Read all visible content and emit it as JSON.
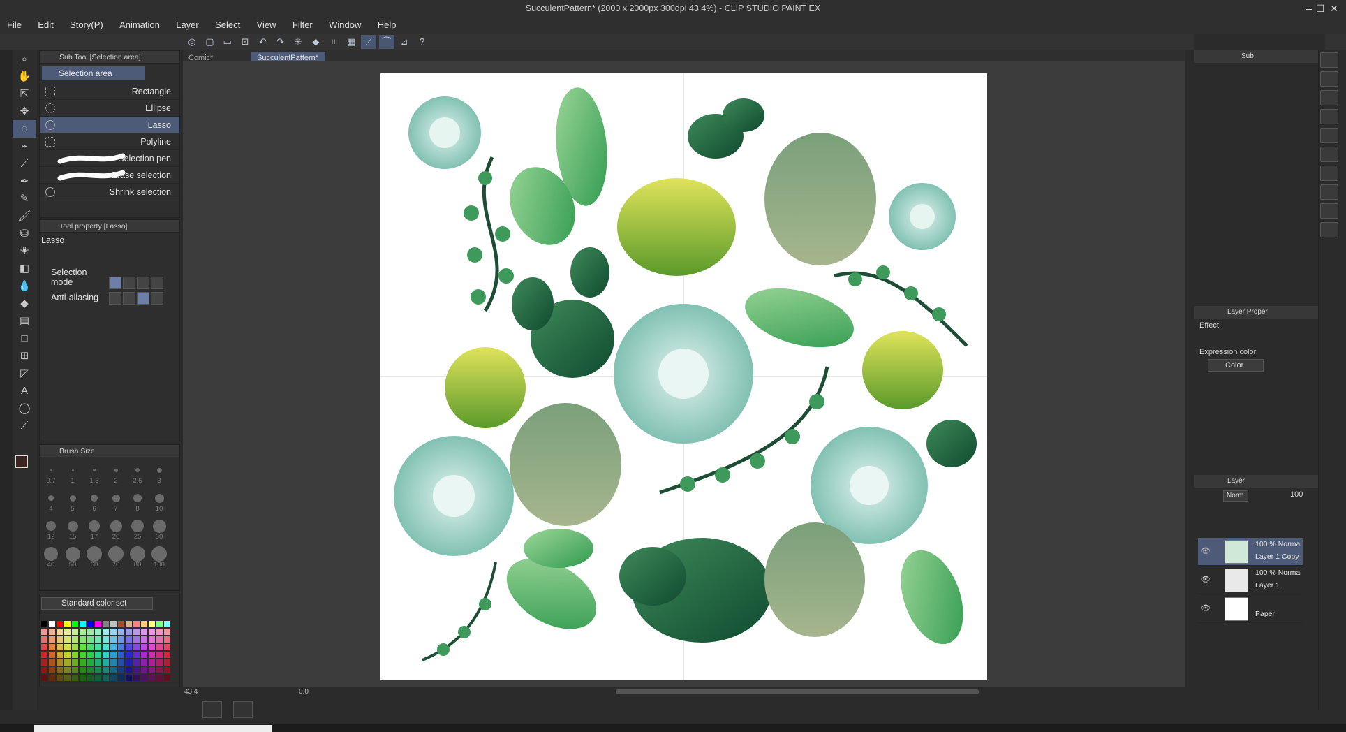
{
  "window": {
    "title": "SucculentPattern* (2000 x 2000px 300dpi 43.4%)  - CLIP STUDIO PAINT EX"
  },
  "menu": [
    "File",
    "Edit",
    "Story(P)",
    "Animation",
    "Layer",
    "Select",
    "View",
    "Filter",
    "Window",
    "Help"
  ],
  "tabs": [
    {
      "label": "Comic*"
    },
    {
      "label": "SucculentPattern*"
    }
  ],
  "subtool_panel": {
    "header": "Sub Tool [Selection area]",
    "group": "Selection area",
    "items": [
      "Rectangle",
      "Ellipse",
      "Lasso",
      "Polyline",
      "Selection pen",
      "Erase selection",
      "Shrink selection"
    ],
    "selected": "Lasso"
  },
  "tool_property": {
    "header": "Tool property [Lasso]",
    "tool_name": "Lasso",
    "selection_mode_label": "Selection mode",
    "anti_aliasing_label": "Anti-aliasing"
  },
  "brush_size": {
    "header": "Brush Size",
    "sizes": [
      "0.7",
      "1",
      "1.5",
      "2",
      "2.5",
      "3",
      "4",
      "5",
      "6",
      "7",
      "8",
      "10",
      "12",
      "15",
      "17",
      "20",
      "25",
      "30",
      "40",
      "50",
      "60",
      "70",
      "80",
      "100"
    ]
  },
  "color_set": {
    "label": "Standard color set"
  },
  "status": {
    "zoom": "43.4",
    "angle": "0.0"
  },
  "right": {
    "sub_tab": "Sub",
    "layer_property_header": "Layer Proper",
    "effect_label": "Effect",
    "expression_color_label": "Expression color",
    "expression_color_value": "Color",
    "layer_header": "Layer",
    "blend_mode": "Norm",
    "opacity": "100"
  },
  "layers": [
    {
      "line1": "100 % Normal",
      "line2": "Layer 1 Copy"
    },
    {
      "line1": "100 % Normal",
      "line2": "Layer 1"
    },
    {
      "line1": "",
      "line2": "Paper"
    }
  ],
  "colors": {
    "accent": "#4d5a78",
    "bg": "#2b2b2b",
    "paper": "#ffffff"
  }
}
